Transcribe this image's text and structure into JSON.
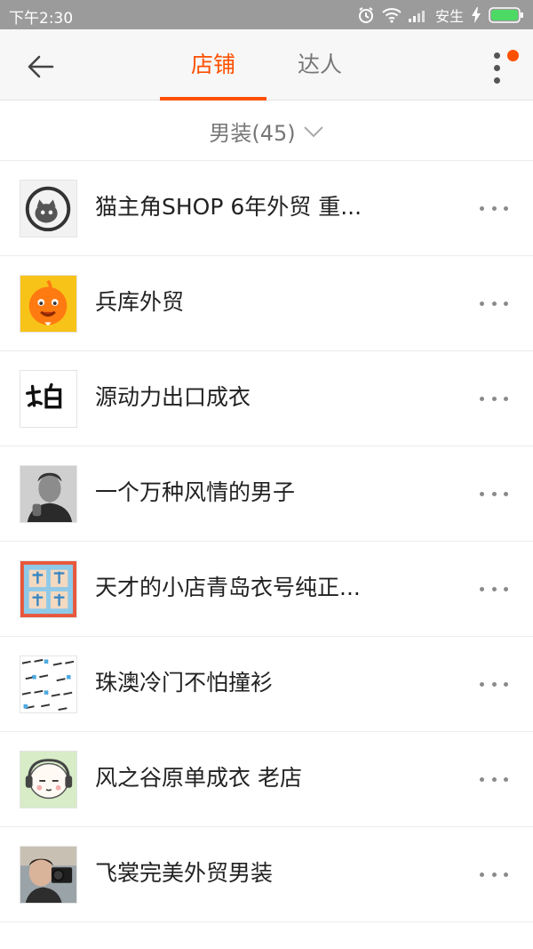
{
  "status_bar": {
    "time": "下午2:30",
    "carrier": "安生",
    "icons": [
      "alarm-icon",
      "wifi-icon",
      "signal-icon",
      "charging-icon",
      "battery-icon"
    ],
    "battery_color": "#4cd964"
  },
  "nav": {
    "back_icon": "back-arrow-icon",
    "tabs": [
      {
        "label": "店铺",
        "active": true
      },
      {
        "label": "达人",
        "active": false
      }
    ],
    "more_icon": "vertical-dots-icon",
    "accent_color": "#ff5000"
  },
  "filter": {
    "label": "男装(45)",
    "icon": "chevron-down-icon"
  },
  "shops": [
    {
      "name": "猫主角SHOP 6年外贸 重...",
      "avatar": "black-cat-logo"
    },
    {
      "name": "兵库外贸",
      "avatar": "orange-mascot-logo"
    },
    {
      "name": "源动力出口成衣",
      "avatar": "laobai-calligraphy-logo"
    },
    {
      "name": "一个万种风情的男子",
      "avatar": "man-portrait-photo"
    },
    {
      "name": "天才的小店青岛衣号纯正...",
      "avatar": "tiancai-xiaodian-logo"
    },
    {
      "name": "珠澳冷门不怕撞衫",
      "avatar": "zhuao-pattern-logo"
    },
    {
      "name": "风之谷原单成衣 老店",
      "avatar": "cartoon-headphones-avatar"
    },
    {
      "name": "飞裳完美外贸男装",
      "avatar": "man-camera-photo"
    }
  ]
}
